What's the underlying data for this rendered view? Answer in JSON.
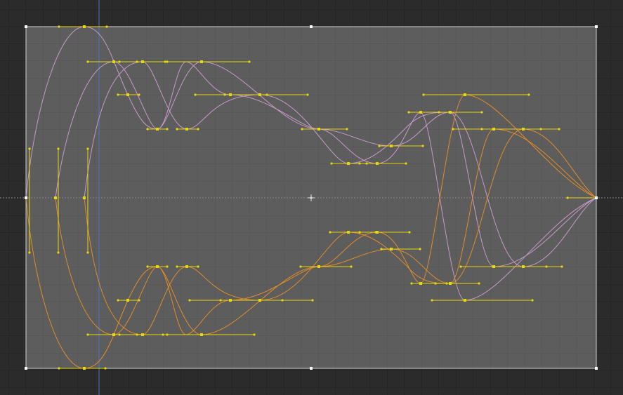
{
  "colors": {
    "background": "#2b2b2b",
    "grid_line": "#1f1f1f",
    "bounds_fill": "#5d5d5d",
    "bounds_grid": "#535353",
    "bounds_border": "#d2d2d2",
    "curve_pink": "#c79ac9",
    "curve_orange": "#e08c2a",
    "handle": "#e8d60e",
    "vertical_guide": "#4d74c2",
    "horizontal_guide": "#8e8e8e",
    "transform_handle": "#ffffff"
  },
  "icons": {
    "center_pivot": "center-pivot-icon"
  }
}
